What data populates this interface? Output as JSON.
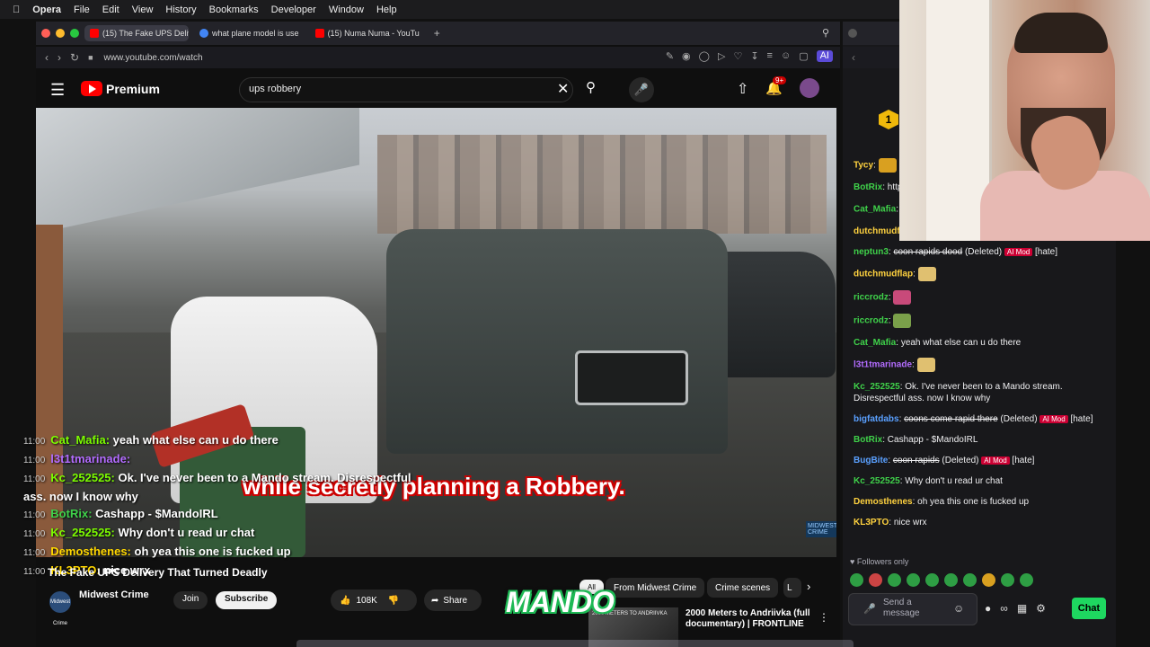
{
  "menubar": {
    "app": "Opera",
    "items": [
      "File",
      "Edit",
      "View",
      "History",
      "Bookmarks",
      "Developer",
      "Window",
      "Help"
    ]
  },
  "browser": {
    "tabs": [
      {
        "label": "(15) The Fake UPS Deliv",
        "active": true
      },
      {
        "label": "what plane model is use",
        "active": false
      },
      {
        "label": "(15) Numa Numa - YouTu",
        "active": false
      }
    ],
    "url": "www.youtube.com/watch",
    "ai_label": "AI"
  },
  "youtube": {
    "brand": "Premium",
    "search_query": "ups robbery",
    "notification_count": "9+",
    "caption": "while secretly planning a Robbery.",
    "watermark": "MIDWEST CRIME",
    "video_title": "The Fake UPS Delivery That Turned Deadly",
    "channel": {
      "name": "Midwest Crime",
      "avatar_text": "Midwest Crime",
      "join_label": "Join",
      "subscribe_label": "Subscribe"
    },
    "likes": "108K",
    "share_label": "Share",
    "chips": [
      "All",
      "From Midwest Crime",
      "Crime scenes",
      "L"
    ],
    "recommendation": {
      "thumb_text": "2000 METERS TO ANDRIIVKA",
      "title": "2000 Meters to Andriivka (full documentary) | FRONTLINE"
    }
  },
  "overlay_chat": [
    {
      "time": "11:00",
      "user": "Cat_Mafia",
      "text": "yeah what else can u do there",
      "color": "#7CFC00"
    },
    {
      "time": "11:00",
      "user": "l3t1tmarinade",
      "text": "",
      "color": "#b36cff"
    },
    {
      "time": "11:00",
      "user": "Kc_252525",
      "text": "Ok. I've never been to a Mando stream. Disrespectful",
      "color": "#7CFC00"
    },
    {
      "time": "",
      "user": "",
      "text": "ass. now I know why",
      "color": "#ffffff"
    },
    {
      "time": "11:00",
      "user": "BotRix",
      "text": "Cashapp - $MandoIRL",
      "color": "#3fd14a"
    },
    {
      "time": "11:00",
      "user": "Kc_252525",
      "text": "Why don't u read ur chat",
      "color": "#7CFC00"
    },
    {
      "time": "11:00",
      "user": "Demosthenes",
      "text": "oh yea this one is fucked up",
      "color": "#ffd700"
    },
    {
      "time": "11:00",
      "user": "KL3PTO",
      "text": "nice wrx",
      "color": "#ffd700"
    }
  ],
  "overlay_brand": "MANDO",
  "rank_badge": "1",
  "chat": {
    "messages": [
      {
        "user": "Tycy",
        "text": "",
        "color": "#ffd23f"
      },
      {
        "user": "BotRix",
        "text": "https://pow",
        "color": "#3fd14a"
      },
      {
        "user": "Cat_Mafia",
        "text": "",
        "color": "#3fd14a"
      },
      {
        "user": "dutchmudflap",
        "text": "L",
        "color": "#ffd23f"
      },
      {
        "user": "neptun3",
        "text": "coon rapids dood",
        "deleted": "(Deleted)",
        "mod": "AI Mod",
        "tag": "[hate]",
        "color": "#3fd14a"
      },
      {
        "user": "dutchmudflap",
        "text": "",
        "color": "#ffd23f"
      },
      {
        "user": "riccrodz",
        "text": "",
        "color": "#3fd14a"
      },
      {
        "user": "riccrodz",
        "text": "",
        "color": "#3fd14a"
      },
      {
        "user": "Cat_Mafia",
        "text": "yeah what else can u do there",
        "color": "#3fd14a"
      },
      {
        "user": "l3t1tmarinade",
        "text": "",
        "color": "#b36cff"
      },
      {
        "user": "Kc_252525",
        "text": "Ok. I've never been to a Mando stream. Disrespectful ass. now I know why",
        "color": "#3fd14a"
      },
      {
        "user": "bigfatdabs",
        "text": "coons come rapid there",
        "deleted": "(Deleted)",
        "mod": "AI Mod",
        "tag": "[hate]",
        "color": "#5aa0ff"
      },
      {
        "user": "BotRix",
        "text": "Cashapp - $MandoIRL",
        "color": "#3fd14a"
      },
      {
        "user": "BugBite",
        "text": "coon rapids",
        "deleted": "(Deleted)",
        "mod": "AI Mod",
        "tag": "[hate]",
        "color": "#5aa0ff"
      },
      {
        "user": "Kc_252525",
        "text": "Why don't u read ur chat",
        "color": "#3fd14a"
      },
      {
        "user": "Demosthenes",
        "text": "oh yea this one is fucked up",
        "color": "#ffd23f"
      },
      {
        "user": "KL3PTO",
        "text": "nice wrx",
        "color": "#ffd23f"
      }
    ],
    "followers_only": "Followers only",
    "input_placeholder": "Send a message",
    "chat_button": "Chat"
  }
}
